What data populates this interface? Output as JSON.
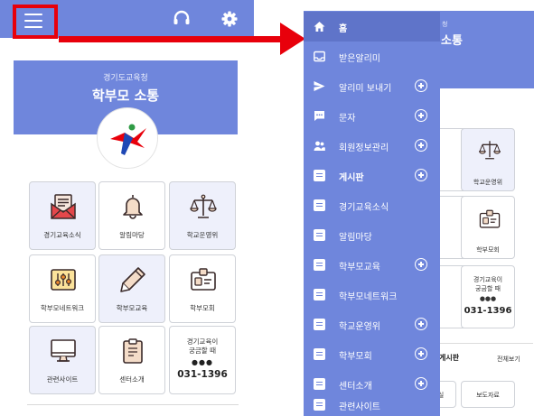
{
  "left": {
    "hero": {
      "subtitle": "경기도교육청",
      "title": "학부모 소통"
    },
    "tiles": [
      {
        "label": "경기교육소식"
      },
      {
        "label": "알림마당"
      },
      {
        "label": "학교운영위"
      },
      {
        "label": "학부모네트워크"
      },
      {
        "label": "학부모교육"
      },
      {
        "label": "학부모회"
      },
      {
        "label": "관련사이트"
      },
      {
        "label": "센터소개"
      }
    ],
    "call_tile": {
      "line1": "경기교육이",
      "line2": "궁금할 때",
      "dots": "●●●",
      "phone": "031-1396"
    }
  },
  "right": {
    "hero_title": "소통",
    "hero_sub": "청",
    "tiles": [
      {
        "label": "학교운영위"
      },
      {
        "label": "학부모회"
      }
    ],
    "call_tile": {
      "line1": "경기교육이",
      "line2": "궁금할 때",
      "dots": "●●●",
      "phone": "031-1396"
    },
    "section_title": "게시판",
    "section_more": "전체보기",
    "bottom_btn": "보도자료",
    "bottom_btn_partial": "실",
    "menu": [
      {
        "label": "홈",
        "icon": "home-icon",
        "expand": false
      },
      {
        "label": "받은알리미",
        "icon": "inbox-icon",
        "expand": false
      },
      {
        "label": "알리미 보내기",
        "icon": "send-icon",
        "expand": true
      },
      {
        "label": "문자",
        "icon": "message-icon",
        "expand": true
      },
      {
        "label": "회원정보관리",
        "icon": "users-icon",
        "expand": true
      },
      {
        "label": "게시판",
        "icon": "board-icon",
        "expand": true
      },
      {
        "label": "경기교육소식",
        "icon": "board-icon",
        "expand": false
      },
      {
        "label": "알림마당",
        "icon": "board-icon",
        "expand": false
      },
      {
        "label": "학부모교육",
        "icon": "board-icon",
        "expand": true
      },
      {
        "label": "학부모네트워크",
        "icon": "board-icon",
        "expand": false
      },
      {
        "label": "학교운영위",
        "icon": "board-icon",
        "expand": true
      },
      {
        "label": "학부모회",
        "icon": "board-icon",
        "expand": true
      },
      {
        "label": "센터소개",
        "icon": "board-icon",
        "expand": true
      },
      {
        "label": "관련사이트",
        "icon": "board-icon",
        "expand": false
      }
    ]
  },
  "colors": {
    "primary": "#6f86dc",
    "active": "#5f74c9",
    "accent_red": "#e8000b",
    "tile_shade": "#eef0fb"
  }
}
